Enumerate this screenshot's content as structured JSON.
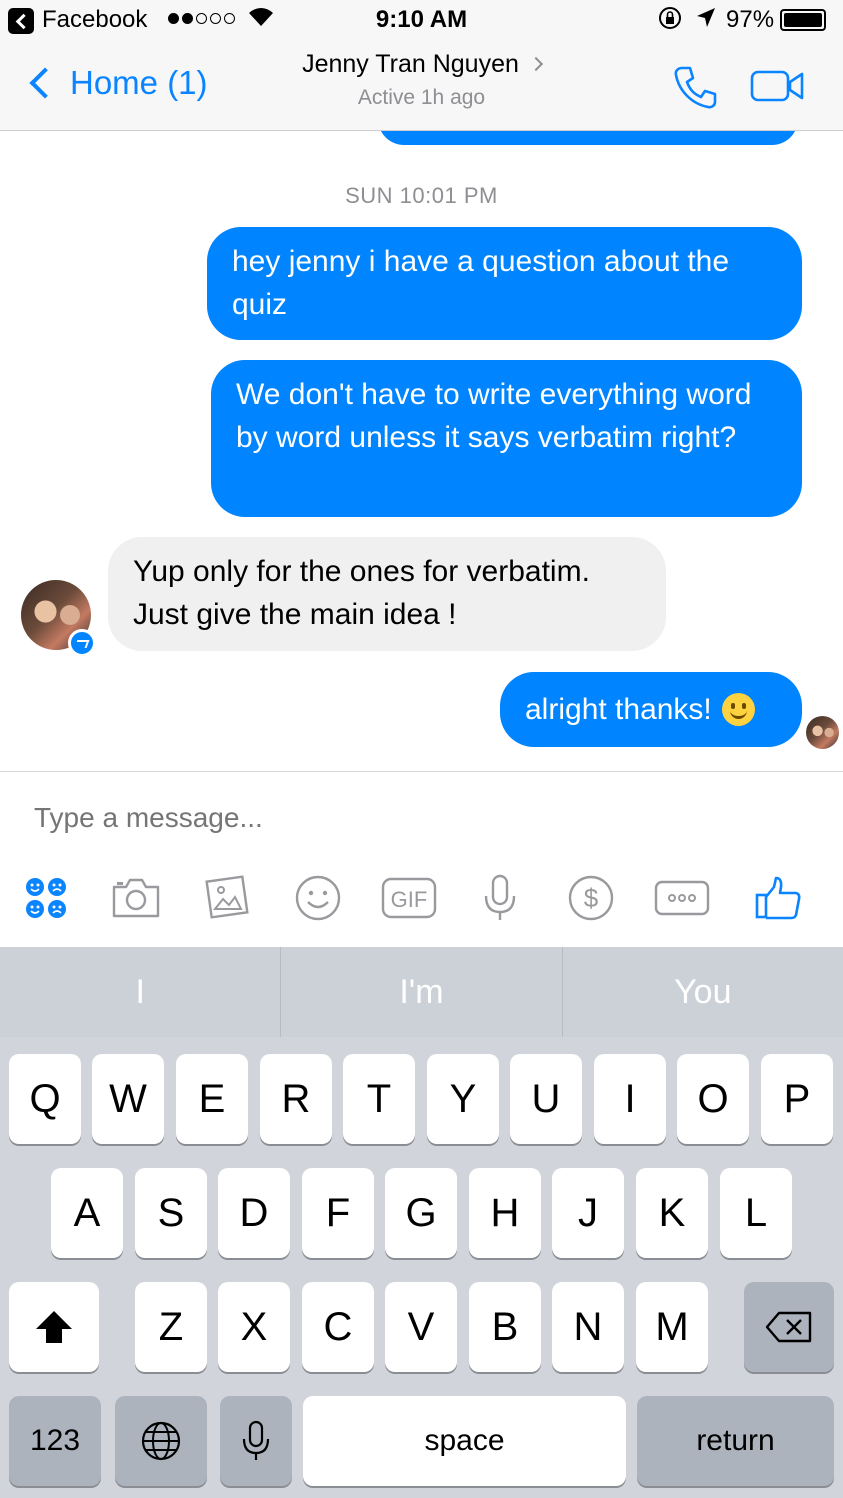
{
  "status_bar": {
    "carrier": "Facebook",
    "time": "9:10 AM",
    "battery": "97%"
  },
  "nav": {
    "back_label": "Home (1)",
    "contact_name": "Jenny Tran Nguyen",
    "status": "Active 1h ago",
    "icons": [
      "phone-icon",
      "video-camera-icon"
    ],
    "accent_color": "#0a84ff"
  },
  "thread": {
    "timestamp": "SUN 10:01 PM",
    "messages": [
      {
        "direction": "outgoing",
        "text": "hey jenny i have a question about the quiz"
      },
      {
        "direction": "outgoing",
        "text": "We don't have to write everything word by word unless it says verbatim right?"
      },
      {
        "direction": "incoming",
        "text": "Yup only for the ones for verbatim. Just give the main idea !"
      },
      {
        "direction": "outgoing",
        "text": "alright thanks!",
        "emoji": "smiling-face-emoji"
      }
    ],
    "outgoing_color": "#0084ff",
    "incoming_color": "#f0f0f0"
  },
  "composer": {
    "placeholder": "Type a message...",
    "gif_label": "GIF",
    "tools": [
      "stickers-icon",
      "camera-icon",
      "gallery-icon",
      "emoji-icon",
      "gif-icon",
      "microphone-icon",
      "payment-icon",
      "more-icon",
      "thumbs-up-icon"
    ]
  },
  "suggestions": [
    "I",
    "I'm",
    "You"
  ],
  "keyboard": {
    "row1": [
      "Q",
      "W",
      "E",
      "R",
      "T",
      "Y",
      "U",
      "I",
      "O",
      "P"
    ],
    "row2": [
      "A",
      "S",
      "D",
      "F",
      "G",
      "H",
      "J",
      "K",
      "L"
    ],
    "row3": [
      "Z",
      "X",
      "C",
      "V",
      "B",
      "N",
      "M"
    ],
    "numbers_label": "123",
    "space_label": "space",
    "return_label": "return"
  }
}
